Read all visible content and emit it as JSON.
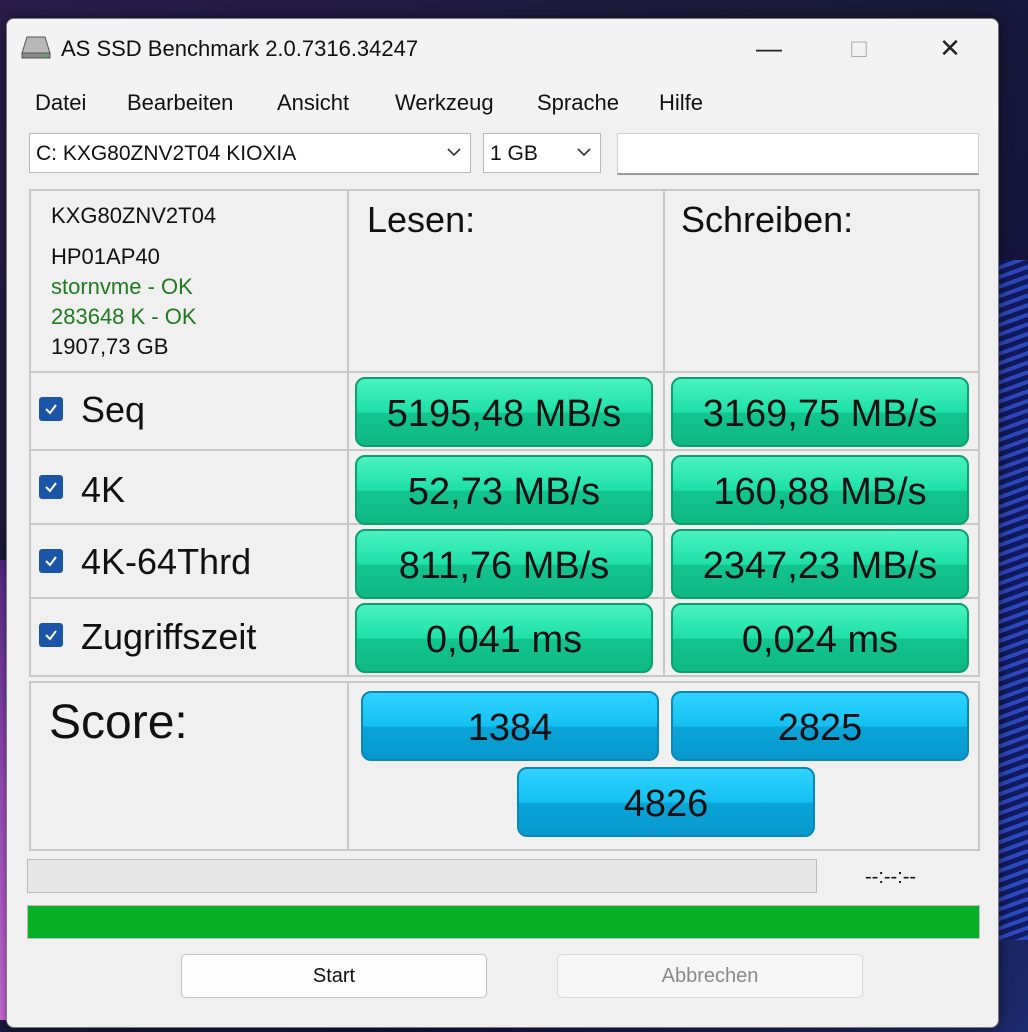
{
  "window": {
    "title": "AS SSD Benchmark 2.0.7316.34247",
    "minimize": "—",
    "maximize": "□",
    "close": "✕"
  },
  "menu": [
    "Datei",
    "Bearbeiten",
    "Ansicht",
    "Werkzeug",
    "Sprache",
    "Hilfe"
  ],
  "drive_select": {
    "value": "C: KXG80ZNV2T04 KIOXIA"
  },
  "size_select": {
    "value": "1 GB"
  },
  "info": {
    "model": "KXG80ZNV2T04",
    "firmware": "HP01AP40",
    "driver": "stornvme - OK",
    "alignment": "283648 K - OK",
    "capacity": "1907,73 GB"
  },
  "headers": {
    "read": "Lesen:",
    "write": "Schreiben:"
  },
  "tests": [
    {
      "label": "Seq",
      "checked": true,
      "read": "5195,48 MB/s",
      "write": "3169,75 MB/s"
    },
    {
      "label": "4K",
      "checked": true,
      "read": "52,73 MB/s",
      "write": "160,88 MB/s"
    },
    {
      "label": "4K-64Thrd",
      "checked": true,
      "read": "811,76 MB/s",
      "write": "2347,23 MB/s"
    },
    {
      "label": "Zugriffszeit",
      "checked": true,
      "read": "0,041 ms",
      "write": "0,024 ms"
    }
  ],
  "score": {
    "label": "Score:",
    "read": "1384",
    "write": "2825",
    "total": "4826"
  },
  "progress": {
    "time": "--:--:--",
    "bar1_fraction": 0,
    "bar2_fraction": 1.0
  },
  "buttons": {
    "start": "Start",
    "abort": "Abbrechen"
  },
  "colors": {
    "result_green": "#1ee0a8",
    "score_blue": "#14c0f0",
    "progress_green": "#06b025",
    "checkbox_blue": "#1a55a8",
    "ok_green": "#1e7a1e"
  }
}
